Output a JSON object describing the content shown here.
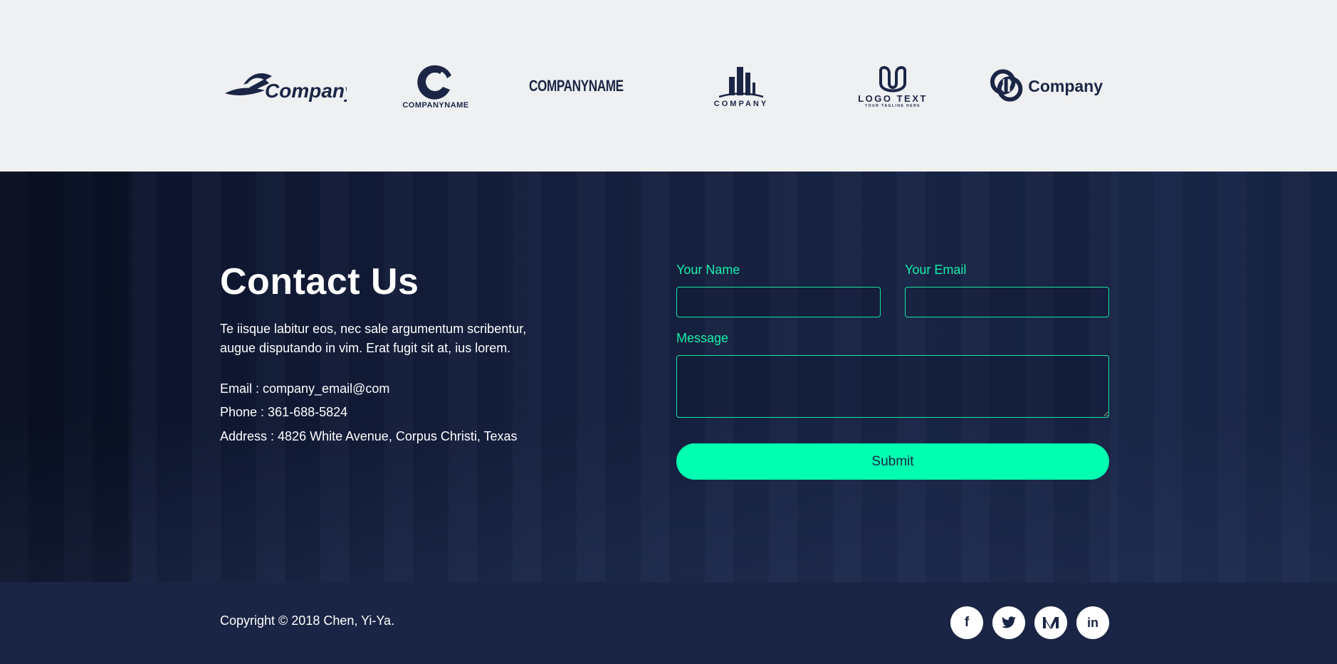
{
  "logos": [
    {
      "name": "Company",
      "style": "swoosh"
    },
    {
      "name": "COMPANYNAME",
      "style": "c-ring"
    },
    {
      "name": "COMPANYNAME",
      "style": "s-block"
    },
    {
      "name": "COMPANY",
      "style": "buildings"
    },
    {
      "name": "LOGO TEXT",
      "tagline": "YOUR TAGLINE HERE",
      "style": "u-loop"
    },
    {
      "name": "Company",
      "style": "chain"
    }
  ],
  "contact": {
    "title": "Contact Us",
    "description": "Te iisque labitur eos, nec sale argumentum scribentur, augue disputando in vim. Erat fugit sit at, ius lorem.",
    "email": "Email : company_email@com",
    "phone": "Phone : 361-688-5824",
    "address": "Address : 4826 White Avenue, Corpus Christi, Texas"
  },
  "form": {
    "name_label": "Your Name",
    "name_value": "",
    "email_label": "Your Email",
    "email_value": "",
    "message_label": "Message",
    "message_value": "",
    "submit_label": "Submit"
  },
  "footer": {
    "copyright": "Copyright © 2018 Chen, Yi-Ya.",
    "social": [
      {
        "name": "facebook-icon",
        "glyph": "f"
      },
      {
        "name": "twitter-icon",
        "glyph": "twitter"
      },
      {
        "name": "medium-icon",
        "glyph": "M"
      },
      {
        "name": "linkedin-icon",
        "glyph": "in"
      }
    ]
  },
  "colors": {
    "accent": "#00ffb0",
    "label": "#14f0a8",
    "navy": "#1a2545",
    "logo_band": "#eef0f2"
  }
}
